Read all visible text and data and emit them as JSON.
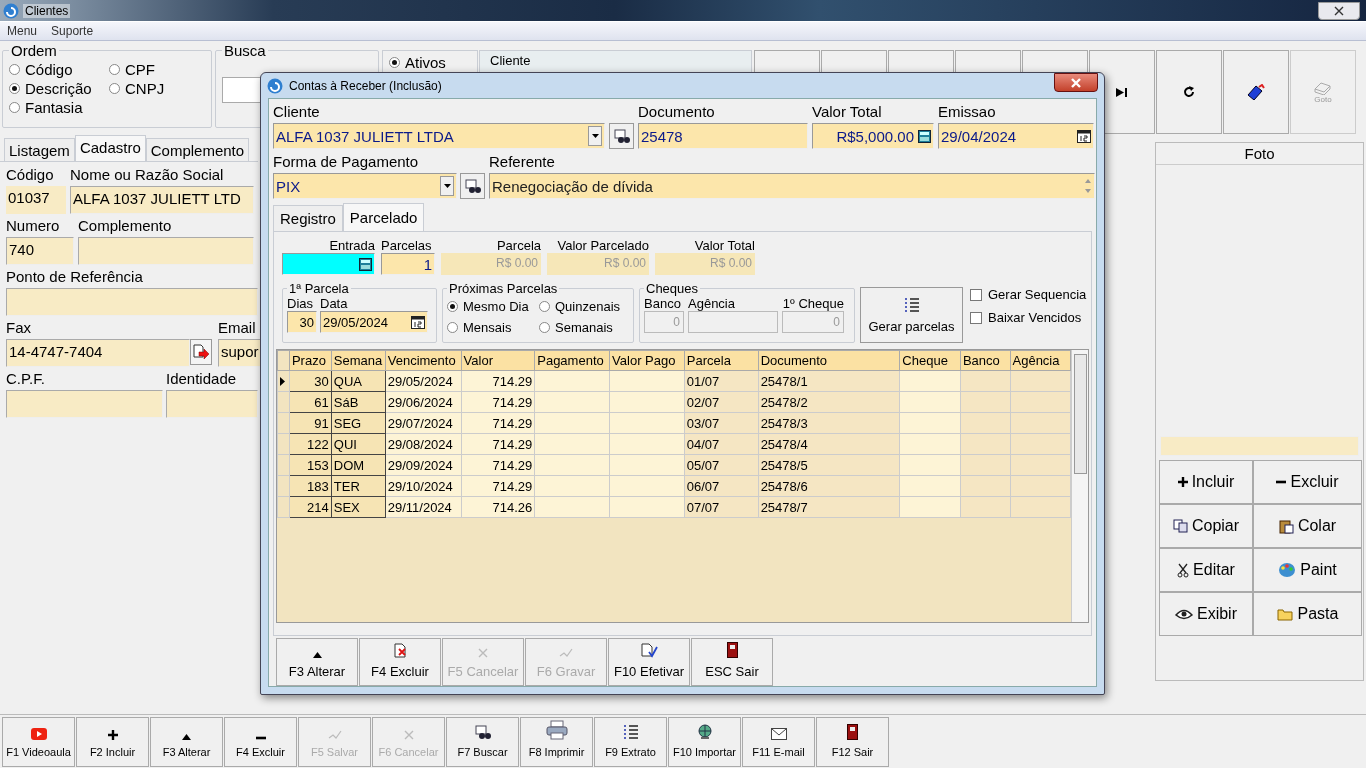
{
  "window": {
    "title": "Clientes"
  },
  "menu": [
    "Menu",
    "Suporte"
  ],
  "ordem": {
    "title": "Ordem",
    "options": [
      {
        "label": "Código",
        "selected": false
      },
      {
        "label": "CPF",
        "selected": false
      },
      {
        "label": "Descrição",
        "selected": true
      },
      {
        "label": "CNPJ",
        "selected": false
      },
      {
        "label": "Fantasia",
        "selected": false
      }
    ]
  },
  "busca": {
    "title": "Busca"
  },
  "status_filter": {
    "label": "Ativos",
    "selected": true
  },
  "cliente_panel": {
    "title": "Cliente"
  },
  "nav_buttons": [
    {
      "disabled": false
    },
    {
      "disabled": false
    },
    {
      "disabled": false
    },
    {
      "disabled": false
    },
    {
      "disabled": false
    },
    {
      "disabled": false
    },
    {
      "disabled": false
    },
    {
      "disabled": false
    },
    {
      "label": "Goto",
      "disabled": true
    }
  ],
  "tabs": [
    {
      "label": "Listagem",
      "selected": false
    },
    {
      "label": "Cadastro",
      "selected": true
    },
    {
      "label": "Complemento",
      "selected": false
    }
  ],
  "form": {
    "codigo": {
      "label": "Código",
      "value": "01037"
    },
    "nome": {
      "label": "Nome ou Razão Social",
      "value": "ALFA 1037 JULIETT LTD"
    },
    "numero": {
      "label": "Numero",
      "value": "740"
    },
    "complemento": {
      "label": "Complemento"
    },
    "ponto_referencia": {
      "label": "Ponto de Referência"
    },
    "fax": {
      "label": "Fax",
      "value": "14-4747-7404"
    },
    "email": {
      "label": "Email",
      "value": "supor"
    },
    "cpf": {
      "label": "C.P.F."
    },
    "identidade": {
      "label": "Identidade"
    }
  },
  "foto": {
    "title": "Foto",
    "buttons": [
      {
        "label": "Incluir"
      },
      {
        "label": "Excluir"
      },
      {
        "label": "Copiar"
      },
      {
        "label": "Colar"
      },
      {
        "label": "Editar"
      },
      {
        "label": "Paint"
      },
      {
        "label": "Exibir"
      },
      {
        "label": "Pasta"
      }
    ]
  },
  "toolbar": [
    {
      "label": "F1 Videoaula",
      "disabled": false
    },
    {
      "label": "F2 Incluir",
      "disabled": false
    },
    {
      "label": "F3 Alterar",
      "disabled": false
    },
    {
      "label": "F4 Excluir",
      "disabled": false
    },
    {
      "label": "F5 Salvar",
      "disabled": true
    },
    {
      "label": "F6 Cancelar",
      "disabled": true
    },
    {
      "label": "F7 Buscar",
      "disabled": false
    },
    {
      "label": "F8 Imprimir",
      "disabled": false
    },
    {
      "label": "F9 Extrato",
      "disabled": false
    },
    {
      "label": "F10 Importar",
      "disabled": false
    },
    {
      "label": "F11 E-mail",
      "disabled": false
    },
    {
      "label": "F12 Sair",
      "disabled": false
    }
  ],
  "dialog": {
    "title": "Contas à Receber (Inclusão)",
    "cliente": {
      "label": "Cliente",
      "value": "ALFA 1037 JULIETT LTDA"
    },
    "documento": {
      "label": "Documento",
      "value": "25478"
    },
    "valor_total": {
      "label": "Valor Total",
      "value": "R$5,000.00"
    },
    "emissao": {
      "label": "Emissao",
      "value": "29/04/2024"
    },
    "forma_pagamento": {
      "label": "Forma de Pagamento",
      "value": "PIX"
    },
    "referente": {
      "label": "Referente",
      "value": "Renegociação de dívida"
    },
    "tabs": [
      {
        "label": "Registro",
        "selected": false
      },
      {
        "label": "Parcelado",
        "selected": true
      }
    ],
    "entrada": {
      "label": "Entrada",
      "focused": true
    },
    "parcelas": {
      "label": "Parcelas",
      "value": "1"
    },
    "summary": [
      {
        "label": "Parcela",
        "value": "R$ 0.00"
      },
      {
        "label": "Valor Parcelado",
        "value": "R$ 0.00"
      },
      {
        "label": "Valor Total",
        "value": "R$ 0.00"
      }
    ],
    "primeira_parcela": {
      "title": "1ª Parcela",
      "dias_label": "Dias",
      "dias": "30",
      "data_label": "Data",
      "data": "29/05/2024"
    },
    "proximas": {
      "title": "Próximas Parcelas",
      "options": [
        {
          "label": "Mesmo Dia",
          "selected": true
        },
        {
          "label": "Quinzenais",
          "selected": false
        },
        {
          "label": "Mensais",
          "selected": false
        },
        {
          "label": "Semanais",
          "selected": false
        }
      ]
    },
    "cheques": {
      "title": "Cheques",
      "fields": [
        {
          "label": "Banco",
          "value": "0"
        },
        {
          "label": "Agência"
        },
        {
          "label": "1º Cheque",
          "value": "0"
        }
      ]
    },
    "gerar_button": {
      "label": "Gerar parcelas"
    },
    "options": [
      {
        "label": "Gerar Sequencia",
        "checked": false
      },
      {
        "label": "Baixar Vencidos",
        "checked": false
      }
    ],
    "table": {
      "columns": [
        "Prazo",
        "Semana",
        "Vencimento",
        "Valor",
        "Pagamento",
        "Valor Pago",
        "Parcela",
        "Documento",
        "Cheque",
        "Banco",
        "Agência"
      ],
      "rows": [
        {
          "selected": true,
          "prazo": "30",
          "semana": "QUA",
          "vencimento": "29/05/2024",
          "valor": "714.29",
          "parcela": "01/07",
          "documento": "25478/1"
        },
        {
          "selected": false,
          "prazo": "61",
          "semana": "SáB",
          "vencimento": "29/06/2024",
          "valor": "714.29",
          "parcela": "02/07",
          "documento": "25478/2"
        },
        {
          "selected": false,
          "prazo": "91",
          "semana": "SEG",
          "vencimento": "29/07/2024",
          "valor": "714.29",
          "parcela": "03/07",
          "documento": "25478/3"
        },
        {
          "selected": false,
          "prazo": "122",
          "semana": "QUI",
          "vencimento": "29/08/2024",
          "valor": "714.29",
          "parcela": "04/07",
          "documento": "25478/4"
        },
        {
          "selected": false,
          "prazo": "153",
          "semana": "DOM",
          "vencimento": "29/09/2024",
          "valor": "714.29",
          "parcela": "05/07",
          "documento": "25478/5"
        },
        {
          "selected": false,
          "prazo": "183",
          "semana": "TER",
          "vencimento": "29/10/2024",
          "valor": "714.29",
          "parcela": "06/07",
          "documento": "25478/6"
        },
        {
          "selected": false,
          "prazo": "214",
          "semana": "SEX",
          "vencimento": "29/11/2024",
          "valor": "714.26",
          "parcela": "07/07",
          "documento": "25478/7"
        }
      ]
    },
    "buttons": [
      {
        "label": "F3 Alterar",
        "disabled": false
      },
      {
        "label": "F4 Excluir",
        "disabled": false
      },
      {
        "label": "F5 Cancelar",
        "disabled": true
      },
      {
        "label": "F6 Gravar",
        "disabled": true
      },
      {
        "label": "F10 Efetivar",
        "disabled": false
      },
      {
        "label": "ESC Sair",
        "disabled": false
      }
    ]
  }
}
